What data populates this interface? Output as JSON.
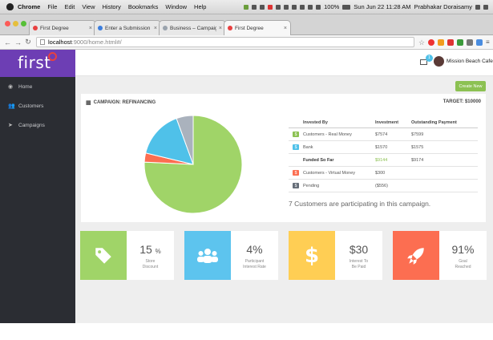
{
  "os_menubar": {
    "app": "Chrome",
    "items": [
      "File",
      "Edit",
      "View",
      "History",
      "Bookmarks",
      "Window",
      "Help"
    ],
    "battery": "100%",
    "clock": "Sun Jun 22  11:28 AM",
    "user": "Prabhakar Doraisamy"
  },
  "browser": {
    "tabs": [
      {
        "title": "First Degree",
        "active": false,
        "favicon_color": "#e84040"
      },
      {
        "title": "Enter a Submission | Sma",
        "active": false,
        "favicon_color": "#3b7ddd"
      },
      {
        "title": "Business – Campaign",
        "active": false,
        "favicon_color": "#9aa3ad"
      },
      {
        "title": "First Degree",
        "active": true,
        "favicon_color": "#e84040"
      }
    ],
    "url_host": "localhost",
    "url_path": ":9000/home.html#/"
  },
  "app": {
    "logo": "first",
    "sidebar": [
      {
        "label": "Home",
        "icon": "dashboard-icon"
      },
      {
        "label": "Customers",
        "icon": "users-icon"
      },
      {
        "label": "Campaigns",
        "icon": "send-icon"
      }
    ],
    "user_name": "Mission Beach Cafe",
    "mail_count": "1"
  },
  "main": {
    "create_button": "Create New",
    "campaign_title": "CAMPAIGN: REFINANCING",
    "target": "TARGET: $10000",
    "table": {
      "headers": [
        "Invested By",
        "Investment",
        "Outstanding Payment"
      ],
      "rows": [
        {
          "badge": "$",
          "color": "#8cc152",
          "label": "Customers - Real Money",
          "investment": "$7574",
          "outstanding": "$7599",
          "style": "normal"
        },
        {
          "badge": "$",
          "color": "#4fc1e9",
          "label": "Bank",
          "investment": "$1570",
          "outstanding": "$1575",
          "style": "normal"
        },
        {
          "badge": "",
          "color": "",
          "label": "Funded So Far",
          "investment": "$9144",
          "outstanding": "$9174",
          "style": "total"
        },
        {
          "badge": "$",
          "color": "#fc6e51",
          "label": "Customers - Virtual Money",
          "investment": "$300",
          "outstanding": "",
          "style": "normal"
        },
        {
          "badge": "$",
          "color": "#656d78",
          "label": "Pending",
          "investment": "($556)",
          "outstanding": "",
          "style": "normal"
        }
      ]
    },
    "customers_line": "7 Customers are participating in this campaign.",
    "pie": {
      "slices": [
        {
          "label": "Customers - Real Money",
          "value": 7574,
          "color": "#a0d468"
        },
        {
          "label": "Customers - Virtual Money",
          "value": 300,
          "color": "#fc6e51"
        },
        {
          "label": "Bank",
          "value": 1570,
          "color": "#4fc1e9"
        },
        {
          "label": "Pending",
          "value": 556,
          "color": "#aab2bd"
        }
      ]
    },
    "stats": [
      {
        "value": "15",
        "unit": "%",
        "label1": "Store",
        "label2": "Discount",
        "color": "#a0d468",
        "icon": "tag-icon"
      },
      {
        "value": "4%",
        "unit": "",
        "label1": "Participant",
        "label2": "Interest Rate",
        "color": "#5dc4ee",
        "icon": "users-icon"
      },
      {
        "value": "$30",
        "unit": "",
        "label1": "Interest To",
        "label2": "Be Paid",
        "color": "#ffce54",
        "icon": "dollar-icon"
      },
      {
        "value": "91%",
        "unit": "",
        "label1": "Goal",
        "label2": "Reached",
        "color": "#fc6e51",
        "icon": "rocket-icon"
      }
    ]
  }
}
